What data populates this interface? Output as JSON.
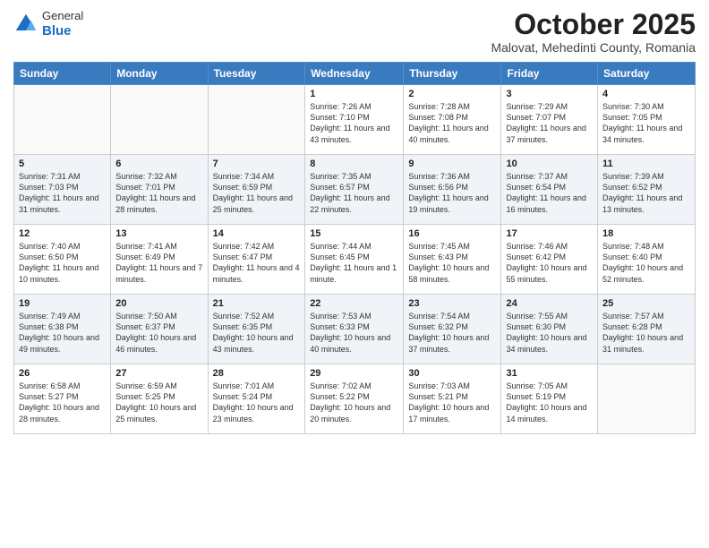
{
  "logo": {
    "general": "General",
    "blue": "Blue"
  },
  "title": "October 2025",
  "subtitle": "Malovat, Mehedinti County, Romania",
  "days_of_week": [
    "Sunday",
    "Monday",
    "Tuesday",
    "Wednesday",
    "Thursday",
    "Friday",
    "Saturday"
  ],
  "weeks": [
    [
      {
        "day": "",
        "info": ""
      },
      {
        "day": "",
        "info": ""
      },
      {
        "day": "",
        "info": ""
      },
      {
        "day": "1",
        "info": "Sunrise: 7:26 AM\nSunset: 7:10 PM\nDaylight: 11 hours and 43 minutes."
      },
      {
        "day": "2",
        "info": "Sunrise: 7:28 AM\nSunset: 7:08 PM\nDaylight: 11 hours and 40 minutes."
      },
      {
        "day": "3",
        "info": "Sunrise: 7:29 AM\nSunset: 7:07 PM\nDaylight: 11 hours and 37 minutes."
      },
      {
        "day": "4",
        "info": "Sunrise: 7:30 AM\nSunset: 7:05 PM\nDaylight: 11 hours and 34 minutes."
      }
    ],
    [
      {
        "day": "5",
        "info": "Sunrise: 7:31 AM\nSunset: 7:03 PM\nDaylight: 11 hours and 31 minutes."
      },
      {
        "day": "6",
        "info": "Sunrise: 7:32 AM\nSunset: 7:01 PM\nDaylight: 11 hours and 28 minutes."
      },
      {
        "day": "7",
        "info": "Sunrise: 7:34 AM\nSunset: 6:59 PM\nDaylight: 11 hours and 25 minutes."
      },
      {
        "day": "8",
        "info": "Sunrise: 7:35 AM\nSunset: 6:57 PM\nDaylight: 11 hours and 22 minutes."
      },
      {
        "day": "9",
        "info": "Sunrise: 7:36 AM\nSunset: 6:56 PM\nDaylight: 11 hours and 19 minutes."
      },
      {
        "day": "10",
        "info": "Sunrise: 7:37 AM\nSunset: 6:54 PM\nDaylight: 11 hours and 16 minutes."
      },
      {
        "day": "11",
        "info": "Sunrise: 7:39 AM\nSunset: 6:52 PM\nDaylight: 11 hours and 13 minutes."
      }
    ],
    [
      {
        "day": "12",
        "info": "Sunrise: 7:40 AM\nSunset: 6:50 PM\nDaylight: 11 hours and 10 minutes."
      },
      {
        "day": "13",
        "info": "Sunrise: 7:41 AM\nSunset: 6:49 PM\nDaylight: 11 hours and 7 minutes."
      },
      {
        "day": "14",
        "info": "Sunrise: 7:42 AM\nSunset: 6:47 PM\nDaylight: 11 hours and 4 minutes."
      },
      {
        "day": "15",
        "info": "Sunrise: 7:44 AM\nSunset: 6:45 PM\nDaylight: 11 hours and 1 minute."
      },
      {
        "day": "16",
        "info": "Sunrise: 7:45 AM\nSunset: 6:43 PM\nDaylight: 10 hours and 58 minutes."
      },
      {
        "day": "17",
        "info": "Sunrise: 7:46 AM\nSunset: 6:42 PM\nDaylight: 10 hours and 55 minutes."
      },
      {
        "day": "18",
        "info": "Sunrise: 7:48 AM\nSunset: 6:40 PM\nDaylight: 10 hours and 52 minutes."
      }
    ],
    [
      {
        "day": "19",
        "info": "Sunrise: 7:49 AM\nSunset: 6:38 PM\nDaylight: 10 hours and 49 minutes."
      },
      {
        "day": "20",
        "info": "Sunrise: 7:50 AM\nSunset: 6:37 PM\nDaylight: 10 hours and 46 minutes."
      },
      {
        "day": "21",
        "info": "Sunrise: 7:52 AM\nSunset: 6:35 PM\nDaylight: 10 hours and 43 minutes."
      },
      {
        "day": "22",
        "info": "Sunrise: 7:53 AM\nSunset: 6:33 PM\nDaylight: 10 hours and 40 minutes."
      },
      {
        "day": "23",
        "info": "Sunrise: 7:54 AM\nSunset: 6:32 PM\nDaylight: 10 hours and 37 minutes."
      },
      {
        "day": "24",
        "info": "Sunrise: 7:55 AM\nSunset: 6:30 PM\nDaylight: 10 hours and 34 minutes."
      },
      {
        "day": "25",
        "info": "Sunrise: 7:57 AM\nSunset: 6:28 PM\nDaylight: 10 hours and 31 minutes."
      }
    ],
    [
      {
        "day": "26",
        "info": "Sunrise: 6:58 AM\nSunset: 5:27 PM\nDaylight: 10 hours and 28 minutes."
      },
      {
        "day": "27",
        "info": "Sunrise: 6:59 AM\nSunset: 5:25 PM\nDaylight: 10 hours and 25 minutes."
      },
      {
        "day": "28",
        "info": "Sunrise: 7:01 AM\nSunset: 5:24 PM\nDaylight: 10 hours and 23 minutes."
      },
      {
        "day": "29",
        "info": "Sunrise: 7:02 AM\nSunset: 5:22 PM\nDaylight: 10 hours and 20 minutes."
      },
      {
        "day": "30",
        "info": "Sunrise: 7:03 AM\nSunset: 5:21 PM\nDaylight: 10 hours and 17 minutes."
      },
      {
        "day": "31",
        "info": "Sunrise: 7:05 AM\nSunset: 5:19 PM\nDaylight: 10 hours and 14 minutes."
      },
      {
        "day": "",
        "info": ""
      }
    ]
  ]
}
